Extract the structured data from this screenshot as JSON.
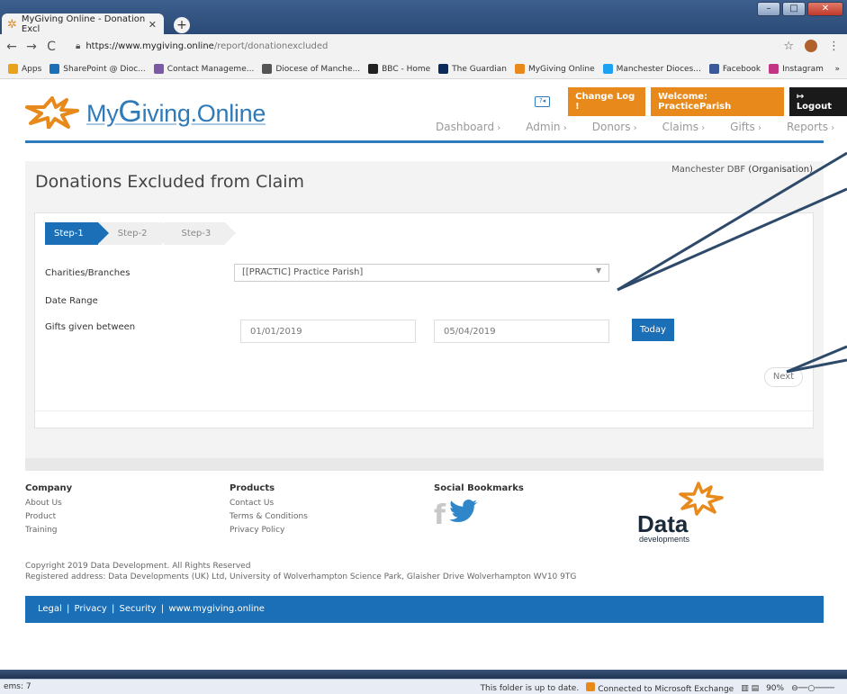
{
  "browser": {
    "tab_title": "MyGiving Online - Donation Excl",
    "url_host": "https://www.mygiving.online",
    "url_path": "/report/donationexcluded",
    "bookmarks": [
      {
        "label": "Apps",
        "color": "#e8a21c"
      },
      {
        "label": "SharePoint @ Dioc...",
        "color": "#1b6fb7"
      },
      {
        "label": "Contact Manageme...",
        "color": "#7a5aa6"
      },
      {
        "label": "Diocese of Manche...",
        "color": "#555555"
      },
      {
        "label": "BBC - Home",
        "color": "#222222"
      },
      {
        "label": "The Guardian",
        "color": "#0a2a5c"
      },
      {
        "label": "MyGiving Online",
        "color": "#e8891c"
      },
      {
        "label": "Manchester Dioces...",
        "color": "#1da1f2"
      },
      {
        "label": "Facebook",
        "color": "#3b5998"
      },
      {
        "label": "Instagram",
        "color": "#c13584"
      }
    ],
    "more": "»"
  },
  "header": {
    "logo_my": "My",
    "logo_g": "G",
    "logo_rest": "iving.Online",
    "changelog": "Change Log !",
    "welcome_prefix": "Welcome: ",
    "welcome_user": "PracticeParish",
    "logout": "Logout",
    "nav": [
      "Dashboard",
      "Admin",
      "Donors",
      "Claims",
      "Gifts",
      "Reports"
    ]
  },
  "main": {
    "title": "Donations Excluded from Claim",
    "org_name": "Manchester DBF",
    "org_type": "(Organisation)",
    "steps": [
      "Step-1",
      "Step-2",
      "Step-3"
    ],
    "labels": {
      "charities": "Charities/Branches",
      "date_range": "Date Range",
      "gifts_between": "Gifts given between"
    },
    "charity_selected": "[[PRACTIC] Practice Parish]",
    "date_from": "01/01/2019",
    "date_to": "05/04/2019",
    "today_label": "Today",
    "next_label": "Next"
  },
  "footer": {
    "company_heading": "Company",
    "company_links": [
      "About Us",
      "Product",
      "Training"
    ],
    "products_heading": "Products",
    "products_links": [
      "Contact Us",
      "Terms & Conditions",
      "Privacy Policy"
    ],
    "social_heading": "Social Bookmarks",
    "data_logo_main": "Data",
    "data_logo_sub": "developments",
    "copyright": "Copyright 2019 Data Development. All Rights Reserved",
    "address": "Registered address: Data Developments (UK) Ltd, University of Wolverhampton Science Park, Glaisher Drive Wolverhampton WV10 9TG",
    "bar_links": [
      "Legal",
      "Privacy",
      "Security",
      "www.mygiving.online"
    ]
  },
  "statusbar": {
    "items": "ems: 7",
    "folder": "This folder is up to date.",
    "exchange": "Connected to Microsoft Exchange",
    "zoom": "90%"
  },
  "colors": {
    "brand_blue": "#2f7ab9",
    "brand_orange": "#e8891c",
    "button_blue": "#1b6fb7",
    "annotation_arrow": "#2e4a6b"
  }
}
